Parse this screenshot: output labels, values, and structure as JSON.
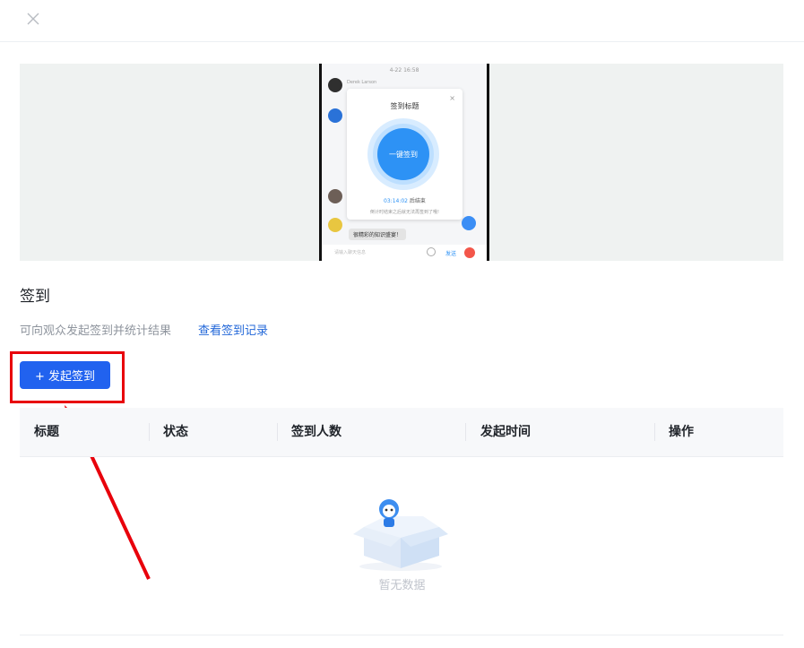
{
  "header": {
    "close_icon": "close-icon"
  },
  "preview": {
    "phone_time": "4-22 16:58",
    "chat_user": "Derek Larson",
    "modal_title": "签到标题",
    "modal_close": "×",
    "modal_button": "一键签到",
    "countdown_time": "03:14:02",
    "countdown_suffix": "后结束",
    "modal_hint": "倒计时结束之后就无法再签到了哦!",
    "chat_message": "很精彩的知识盛宴！",
    "input_placeholder": "请输入聊天信息",
    "send_label": "发送"
  },
  "section": {
    "title": "签到",
    "description": "可向观众发起签到并统计结果",
    "records_link": "查看签到记录",
    "start_button": "+ 发起签到"
  },
  "table": {
    "columns": [
      "标题",
      "状态",
      "签到人数",
      "发起时间",
      "操作"
    ]
  },
  "empty": {
    "text": "暂无数据"
  },
  "colors": {
    "primary": "#2162ef",
    "annotation": "#e8000b",
    "link": "#2267d8"
  }
}
